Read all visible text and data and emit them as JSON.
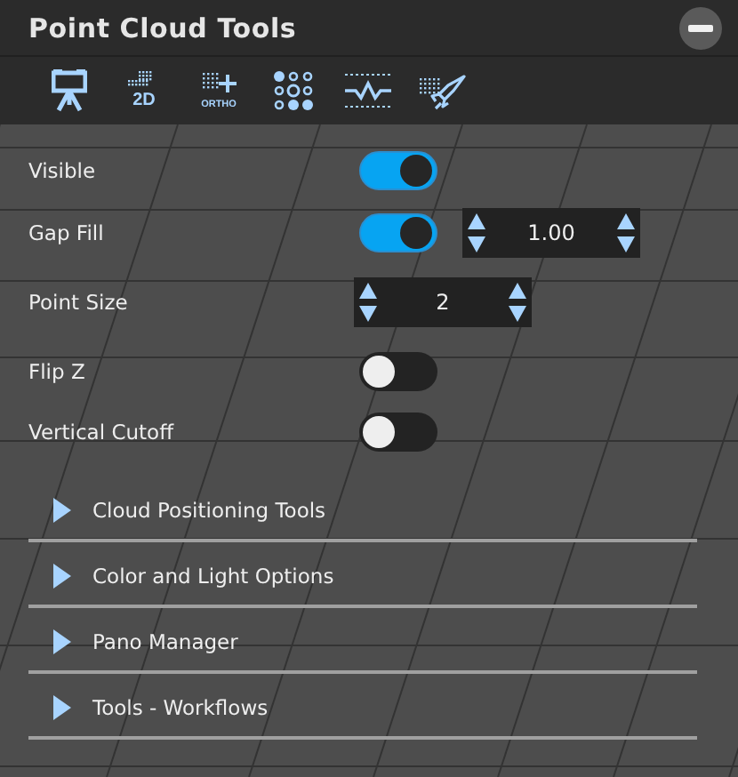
{
  "window": {
    "title": "Point Cloud Tools"
  },
  "toolbar": [
    {
      "kind": "tripod"
    },
    {
      "kind": "dots2d",
      "label": "2D"
    },
    {
      "kind": "ortho",
      "label": "ORTHO"
    },
    {
      "kind": "dotgrid"
    },
    {
      "kind": "wave"
    },
    {
      "kind": "rocket"
    }
  ],
  "settings": [
    {
      "label": "Visible",
      "kind": "toggle",
      "on": true
    },
    {
      "label": "Gap Fill",
      "kind": "toggle_spinner",
      "on": true,
      "value": "1.00"
    },
    {
      "label": "Point Size",
      "kind": "spinner",
      "value": "2"
    },
    {
      "label": "Flip Z",
      "kind": "toggle",
      "on": false
    },
    {
      "label": "Vertical Cutoff",
      "kind": "toggle",
      "on": false
    }
  ],
  "sections": [
    {
      "label": "Cloud Positioning Tools",
      "expanded": false
    },
    {
      "label": "Color and Light Options",
      "expanded": false
    },
    {
      "label": "Pano Manager",
      "expanded": false
    },
    {
      "label": "Tools - Workflows",
      "expanded": false
    }
  ]
}
